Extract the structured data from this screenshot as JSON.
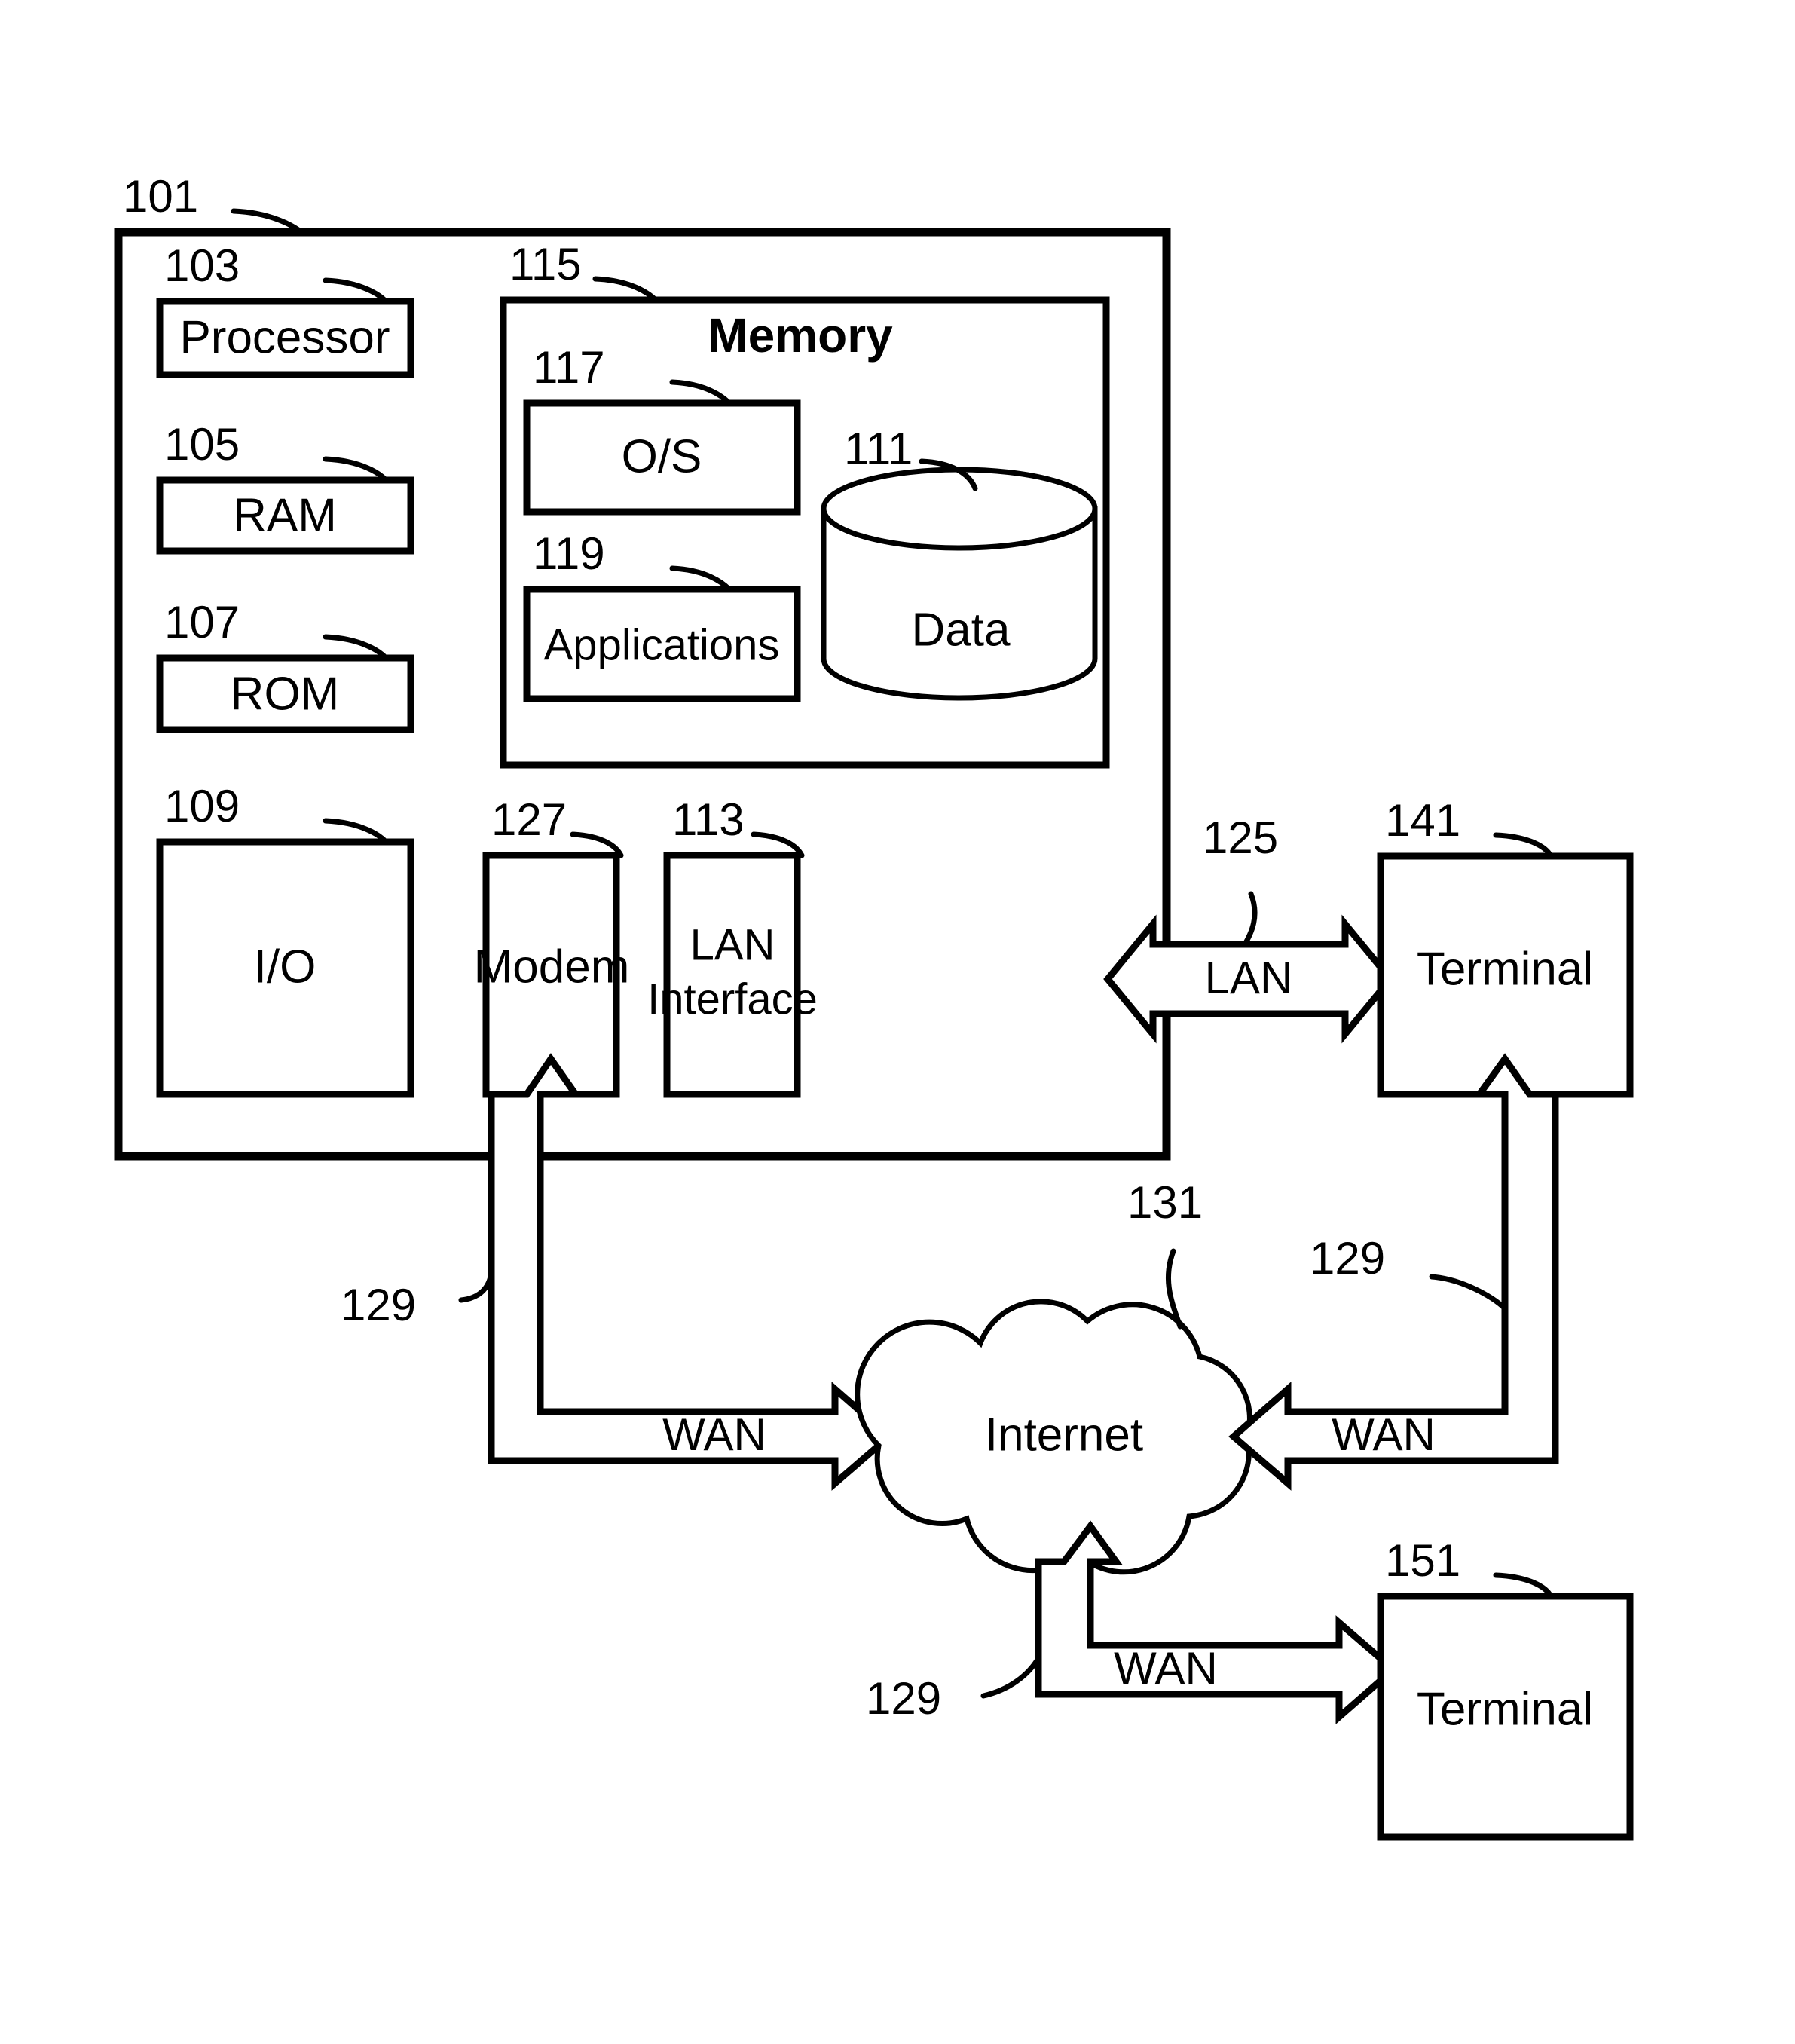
{
  "figure": {
    "title": "Computing device and network environment block diagram",
    "stroke_color": "#000000",
    "background_color": "#ffffff"
  },
  "blocks": {
    "computing_device": {
      "ref": "101",
      "label": ""
    },
    "processor": {
      "ref": "103",
      "label": "Processor"
    },
    "ram": {
      "ref": "105",
      "label": "RAM"
    },
    "rom": {
      "ref": "107",
      "label": "ROM"
    },
    "io": {
      "ref": "109",
      "label": "I/O"
    },
    "memory": {
      "ref": "115",
      "label": "Memory"
    },
    "os": {
      "ref": "117",
      "label": "O/S"
    },
    "applications": {
      "ref": "119",
      "label": "Applications"
    },
    "data": {
      "ref": "111",
      "label": "Data"
    },
    "modem": {
      "ref": "127",
      "label": "Modem"
    },
    "lan_interface": {
      "ref": "113",
      "label_line1": "LAN",
      "label_line2": "Interface"
    },
    "terminal_lan": {
      "ref": "141",
      "label": "Terminal"
    },
    "internet": {
      "ref": "131",
      "label": "Internet"
    },
    "terminal_wan": {
      "ref": "151",
      "label": "Terminal"
    }
  },
  "connections": {
    "lan_link": {
      "ref": "125",
      "label": "LAN"
    },
    "wan_modem": {
      "ref": "129",
      "label": "WAN"
    },
    "wan_terminal141": {
      "ref": "129",
      "label": "WAN"
    },
    "wan_terminal151": {
      "ref": "129",
      "label": "WAN"
    }
  }
}
